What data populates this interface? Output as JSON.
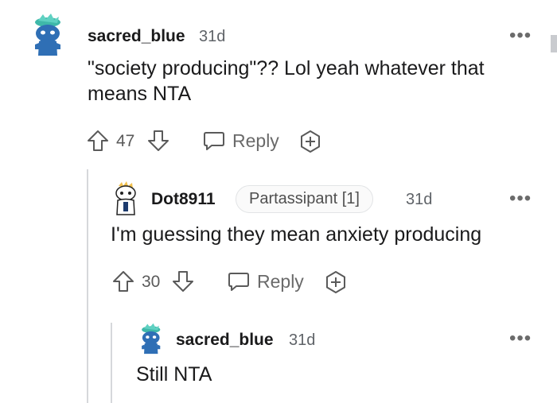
{
  "comments": [
    {
      "username": "sacred_blue",
      "time": "31d",
      "body": "\"society producing\"?? Lol yeah whatever that means NTA",
      "votes": "47",
      "reply_label": "Reply",
      "more_label": "•••"
    },
    {
      "username": "Dot8911",
      "flair": "Partassipant [1]",
      "time": "31d",
      "body": "I'm guessing they mean anxiety producing",
      "votes": "30",
      "reply_label": "Reply",
      "more_label": "•••"
    },
    {
      "username": "sacred_blue",
      "time": "31d",
      "body": "Still NTA",
      "more_label": "•••"
    }
  ],
  "icons": {
    "upvote": "arrow-up-icon",
    "downvote": "arrow-down-icon",
    "reply": "speech-bubble-icon",
    "award": "award-icon",
    "more": "more-options-icon"
  },
  "colors": {
    "text": "#1a1a1b",
    "muted": "#5f6368",
    "thread_line": "#d6d8db",
    "avatar_blue": "#2f6fb5",
    "avatar_teal": "#3fb8a9"
  }
}
